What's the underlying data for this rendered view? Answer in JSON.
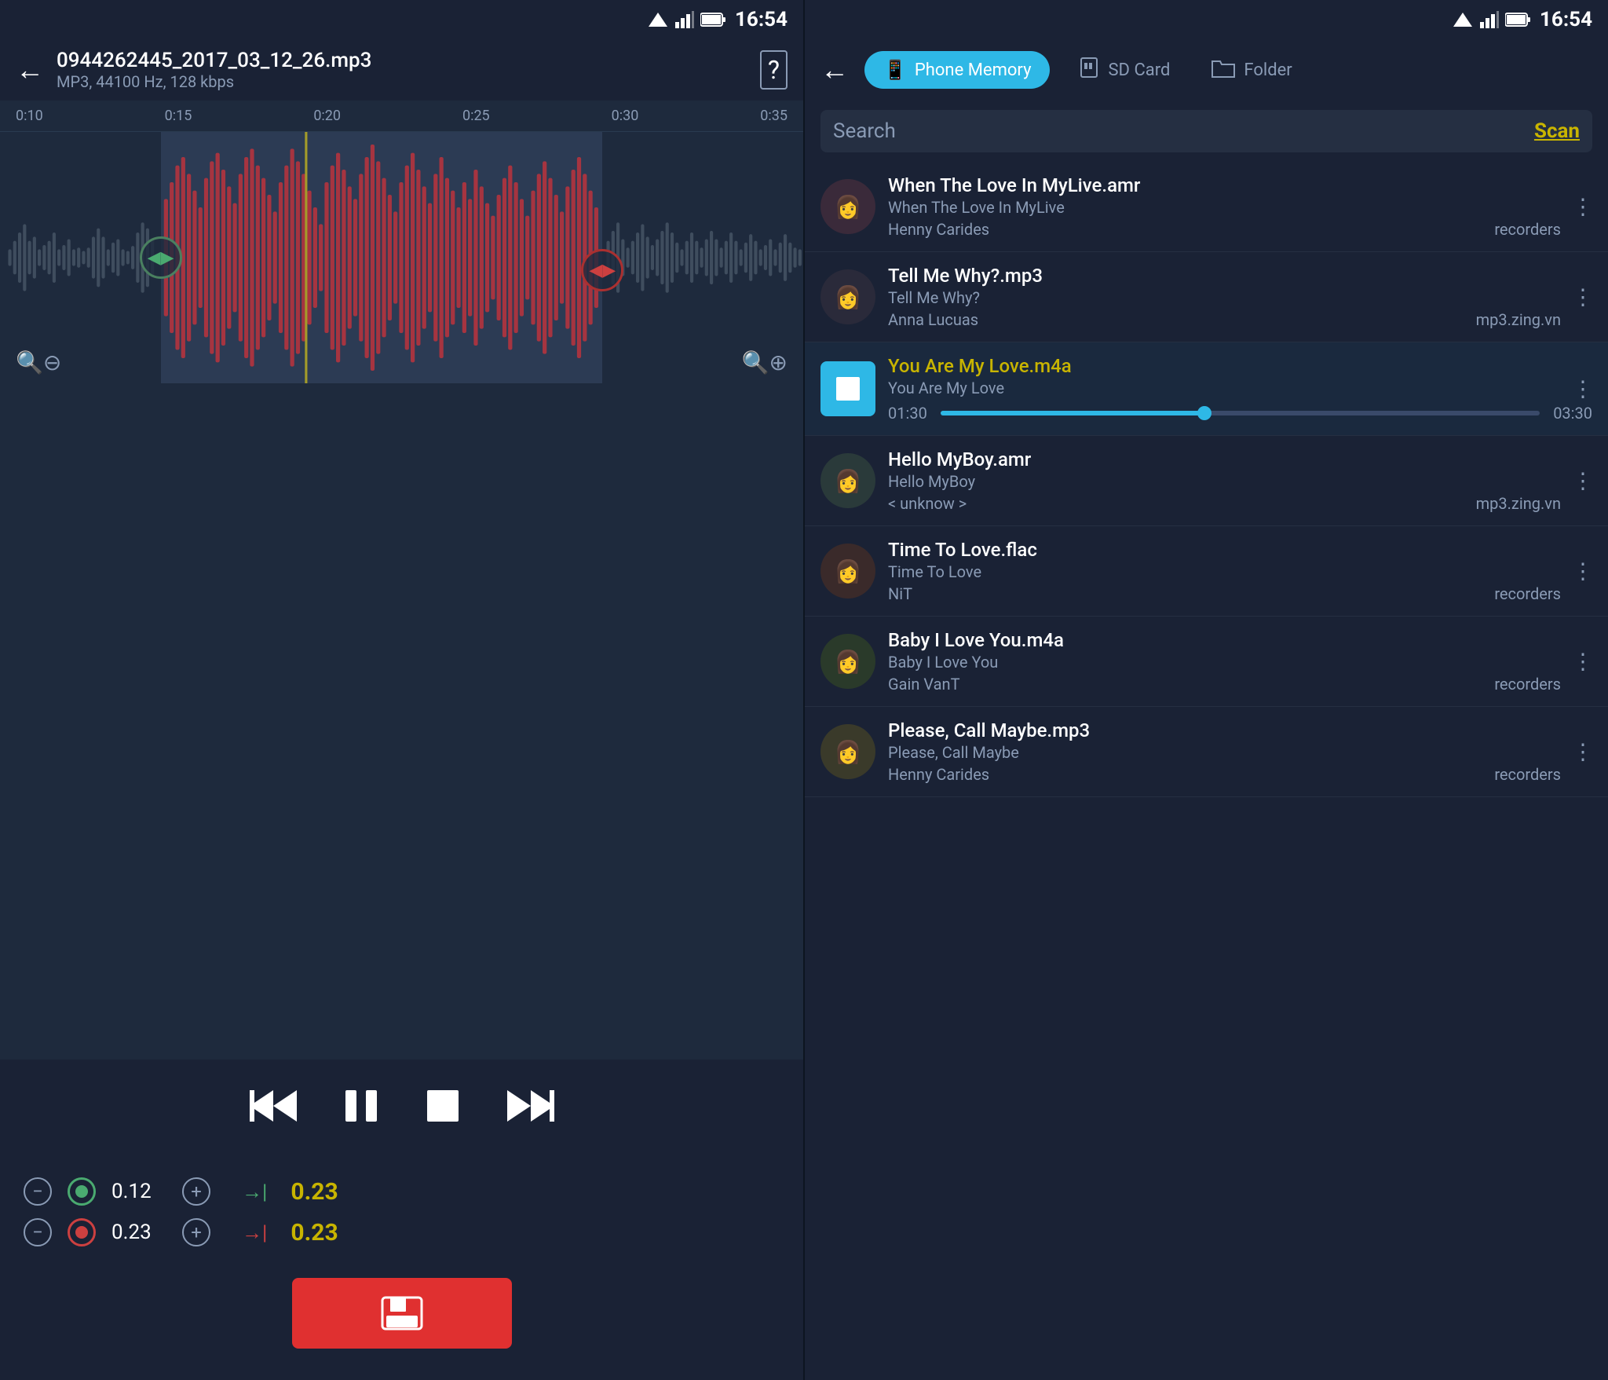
{
  "left": {
    "status": {
      "time": "16:54"
    },
    "header": {
      "back_label": "←",
      "title": "0944262445_2017_03_12_26.mp3",
      "subtitle": "MP3, 44100 Hz, 128 kbps",
      "icon": "?"
    },
    "timeline": {
      "marks": [
        "0:10",
        "0:15",
        "0:20",
        "0:25",
        "0:30",
        "0:35"
      ]
    },
    "controls": {
      "rewind": "⏮",
      "pause": "⏸",
      "stop": "⏹",
      "forward": "⏭"
    },
    "markers": {
      "row1": {
        "value": "0.12",
        "time": "0.23",
        "arrow": "→"
      },
      "row2": {
        "value": "0.23",
        "time": "0.23",
        "arrow": "→"
      }
    },
    "save_label": "💾"
  },
  "right": {
    "status": {
      "time": "16:54"
    },
    "nav": {
      "back_label": "←",
      "tabs": [
        {
          "label": "Phone Memory",
          "active": true,
          "icon": "📱"
        },
        {
          "label": "SD Card",
          "active": false,
          "icon": "💾"
        },
        {
          "label": "Folder",
          "active": false,
          "icon": "📁"
        }
      ]
    },
    "search": {
      "placeholder": "Search",
      "scan_label": "Scan"
    },
    "songs": [
      {
        "title": "When The Love In MyLive.amr",
        "subtitle": "When The Love In MyLive",
        "artist": "Henny Carides",
        "source": "recorders",
        "active": false,
        "avatar_emoji": "👩"
      },
      {
        "title": "Tell Me Why?.mp3",
        "subtitle": "Tell Me Why?",
        "artist": "Anna Lucuas",
        "source": "mp3.zing.vn",
        "active": false,
        "avatar_emoji": "👩"
      },
      {
        "title": "You Are My Love.m4a",
        "subtitle": "You Are My Love",
        "artist": "",
        "source": "",
        "active": true,
        "progress_current": "01:30",
        "progress_end": "03:30",
        "avatar_emoji": "■"
      },
      {
        "title": "Hello MyBoy.amr",
        "subtitle": "Hello MyBoy",
        "artist": "< unknow >",
        "source": "mp3.zing.vn",
        "active": false,
        "avatar_emoji": "👩"
      },
      {
        "title": "Time To Love.flac",
        "subtitle": "Time To Love",
        "artist": "NiT",
        "source": "recorders",
        "active": false,
        "avatar_emoji": "👩"
      },
      {
        "title": "Baby I Love You.m4a",
        "subtitle": "Baby I Love You",
        "artist": "Gain VanT",
        "source": "recorders",
        "active": false,
        "avatar_emoji": "👩"
      },
      {
        "title": "Please, Call Maybe.mp3",
        "subtitle": "Please, Call Maybe",
        "artist": "Henny Carides",
        "source": "recorders",
        "active": false,
        "avatar_emoji": "👩"
      }
    ]
  }
}
